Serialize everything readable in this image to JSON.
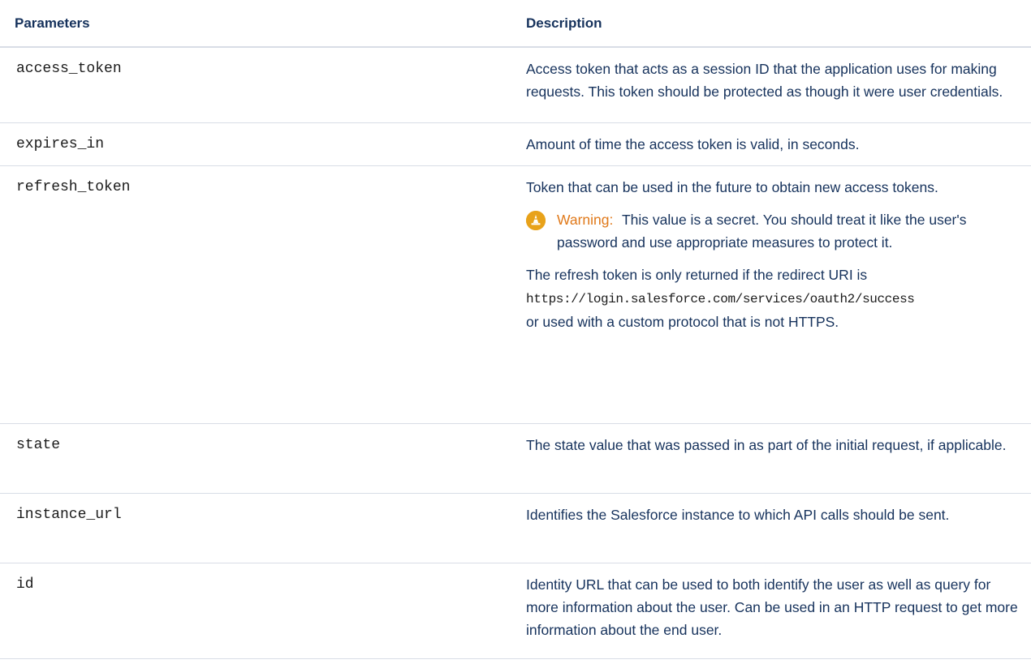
{
  "headers": {
    "parameters": "Parameters",
    "description": "Description"
  },
  "rows": [
    {
      "param": "access_token",
      "description": "Access token that acts as a session ID that the application uses for making requests. This token should be protected as though it were user credentials."
    },
    {
      "param": "expires_in",
      "description": "Amount of time the access token is valid, in seconds."
    },
    {
      "param": "refresh_token",
      "description": "Token that can be used in the future to obtain new access tokens.",
      "warning": {
        "label": "Warning:",
        "text": "This value is a secret. You should treat it like the user's password and use appropriate measures to protect it."
      },
      "note": {
        "before": "The refresh token is only returned if the redirect URI is",
        "code": "https://login.salesforce.com/services/oauth2/success",
        "after": "or used with a custom protocol that is not HTTPS."
      }
    },
    {
      "param": "state",
      "description": "The state value that was passed in as part of the initial request, if applicable."
    },
    {
      "param": "instance_url",
      "description": "Identifies the Salesforce instance to which API calls should be sent."
    },
    {
      "param": "id",
      "description": "Identity URL that can be used to both identify the user as well as query for more information about the user. Can be used in an HTTP request to get more information about the end user."
    }
  ],
  "icons": {
    "warning": "warning-cone-icon"
  },
  "colors": {
    "heading_text": "#16325c",
    "warning_label": "#e0791a",
    "warning_icon_bg": "#e8a21a",
    "row_border": "#d8dde6"
  }
}
